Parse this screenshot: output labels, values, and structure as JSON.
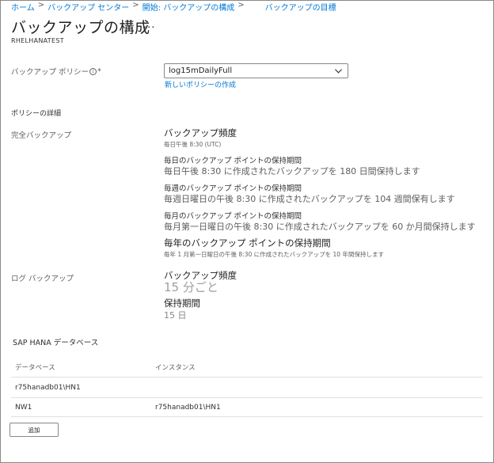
{
  "breadcrumb": {
    "home": "ホーム",
    "center": "バックアップ センター",
    "configure": "開始: バックアップの構成",
    "goal": "バックアップの目標"
  },
  "header": {
    "title": "バックアップの構成",
    "more": "...",
    "subtitle": "RHELHANATEST"
  },
  "policy": {
    "label": "バックアップ ポリシー",
    "required_mark": "*",
    "selected": "log15mDailyFull",
    "new_link": "新しいポリシーの作成"
  },
  "details": {
    "heading": "ポリシーの詳細",
    "full": {
      "label": "完全バックアップ",
      "freq_title": "バックアップ頻度",
      "freq_value": "毎日午後 8:30 (UTC)",
      "daily_title": "毎日のバックアップ ポイントの保持期間",
      "daily_value": "毎日午後 8:30 に作成されたバックアップを 180 日間保持します",
      "weekly_title": "毎週のバックアップ ポイントの保持期間",
      "weekly_value": "毎週日曜日の午後 8:30 に作成されたバックアップを 104 週間保有します",
      "monthly_title": "毎月のバックアップ ポイントの保持期間",
      "monthly_value": "毎月第一日曜日の午後 8:30 に作成されたバックアップを 60 か月間保持します",
      "yearly_title": "毎年のバックアップ ポイントの保持期間",
      "yearly_value": "毎年 1 月第一日曜日の午後 8:30 に作成されたバックアップを 10 年間保持します"
    },
    "log": {
      "label": "ログ バックアップ",
      "freq_title": "バックアップ頻度",
      "freq_value": "15 分ごと",
      "retention_title": "保持期間",
      "retention_value": "15 日"
    }
  },
  "hana": {
    "heading": "SAP HANA データベース",
    "columns": [
      "データベース",
      "インスタンス"
    ],
    "rows": [
      [
        "r75hanadb01\\HN1",
        ""
      ],
      [
        "NW1",
        "r75hanadb01\\HN1"
      ]
    ]
  },
  "add_label": "追加"
}
